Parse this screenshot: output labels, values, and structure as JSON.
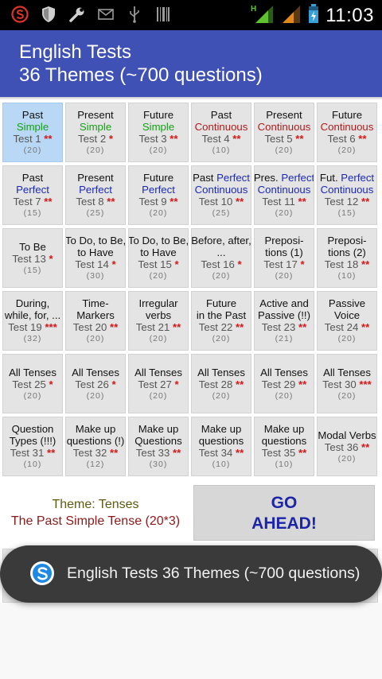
{
  "status_bar": {
    "time": "11:03",
    "left_icons": [
      "app-s-icon",
      "shield-icon",
      "wrench-icon",
      "mail-icon",
      "usb-icon",
      "barcode-icon"
    ],
    "network_label": "H",
    "colors": {
      "signal_green": "#5fc12f",
      "signal_orange": "#e08a1e",
      "battery": "#37a0d8"
    }
  },
  "app_bar": {
    "title": "English Tests",
    "subtitle": "36 Themes (~700 questions)",
    "color": "#3f51b5"
  },
  "tiles": [
    {
      "line1": "Past",
      "line2": "Simple",
      "line2_color": "green",
      "test": "Test 1",
      "stars": "**",
      "count": "(20)",
      "selected": true
    },
    {
      "line1": "Present",
      "line2": "Simple",
      "line2_color": "green",
      "test": "Test 2",
      "stars": "*",
      "count": "(20)"
    },
    {
      "line1": "Future",
      "line2": "Simple",
      "line2_color": "green",
      "test": "Test 3",
      "stars": "**",
      "count": "(20)"
    },
    {
      "line1": "Past",
      "line2": "Continuous",
      "line2_color": "red",
      "test": "Test 4",
      "stars": "**",
      "count": "(10)"
    },
    {
      "line1": "Present",
      "line2": "Continuous",
      "line2_color": "red",
      "test": "Test 5",
      "stars": "**",
      "count": "(20)"
    },
    {
      "line1": "Future",
      "line2": "Continuous",
      "line2_color": "red",
      "test": "Test 6",
      "stars": "**",
      "count": "(20)"
    },
    {
      "line1": "Past",
      "line2": "Perfect",
      "line2_color": "blue",
      "test": "Test 7",
      "stars": "**",
      "count": "(15)"
    },
    {
      "line1": "Present",
      "line2": "Perfect",
      "line2_color": "blue",
      "test": "Test 8",
      "stars": "**",
      "count": "(25)"
    },
    {
      "line1": "Future",
      "line2": "Perfect",
      "line2_color": "blue",
      "test": "Test 9",
      "stars": "**",
      "count": "(20)"
    },
    {
      "line1a": "Past ",
      "line1b": "Perfect",
      "line2": "Continuous",
      "line2_color": "blue",
      "test": "Test 10",
      "stars": "**",
      "count": "(25)"
    },
    {
      "line1a": "Pres. ",
      "line1b": "Perfect",
      "line2": "Continuous",
      "line2_color": "blue",
      "test": "Test 11",
      "stars": "**",
      "count": "(20)"
    },
    {
      "line1a": "Fut. ",
      "line1b": "Perfect",
      "line2": "Continuous",
      "line2_color": "blue",
      "test": "Test 12",
      "stars": "**",
      "count": "(15)"
    },
    {
      "line1": "To Be",
      "test": "Test 13",
      "stars": "*",
      "count": "(15)"
    },
    {
      "line1": "To Do, to Be,",
      "line2": "to Have",
      "test": "Test 14",
      "stars": "*",
      "count": "(30)"
    },
    {
      "line1": "To Do, to Be,",
      "line2": "to Have",
      "test": "Test 15",
      "stars": "*",
      "count": "(20)"
    },
    {
      "line1": "Before, after,",
      "line2": "...",
      "test": "Test 16",
      "stars": "*",
      "count": "(20)"
    },
    {
      "line1": "Preposi-",
      "line2": "tions (1)",
      "test": "Test 17",
      "stars": "*",
      "count": "(20)"
    },
    {
      "line1": "Preposi-",
      "line2": "tions (2)",
      "test": "Test 18",
      "stars": "**",
      "count": "(10)"
    },
    {
      "line1": "During,",
      "line2": "while, for, ...",
      "test": "Test 19",
      "stars": "***",
      "count": "(32)"
    },
    {
      "line1": "Time-",
      "line2": "Markers",
      "test": "Test 20",
      "stars": "**",
      "count": "(20)"
    },
    {
      "line1": "Irregular",
      "line2": "verbs",
      "test": "Test 21",
      "stars": "**",
      "count": "(20)"
    },
    {
      "line1": "Future",
      "line2": "in the Past",
      "test": "Test 22",
      "stars": "**",
      "count": "(20)"
    },
    {
      "line1": "Active and",
      "line2": "Passive (!!)",
      "test": "Test 23",
      "stars": "**",
      "count": "(21)"
    },
    {
      "line1": "Passive",
      "line2": "Voice",
      "test": "Test 24",
      "stars": "**",
      "count": "(20)"
    },
    {
      "line1": "All Tenses",
      "test": "Test 25",
      "stars": "*",
      "count": "(20)"
    },
    {
      "line1": "All Tenses",
      "test": "Test 26",
      "stars": "*",
      "count": "(20)"
    },
    {
      "line1": "All Tenses",
      "test": "Test 27",
      "stars": "*",
      "count": "(20)"
    },
    {
      "line1": "All Tenses",
      "test": "Test 28",
      "stars": "**",
      "count": "(20)"
    },
    {
      "line1": "All Tenses",
      "test": "Test 29",
      "stars": "**",
      "count": "(20)"
    },
    {
      "line1": "All Tenses",
      "test": "Test 30",
      "stars": "***",
      "count": "(20)"
    },
    {
      "line1": "Question",
      "line2": "Types (!!!)",
      "test": "Test 31",
      "stars": "**",
      "count": "(10)"
    },
    {
      "line1": "Make up",
      "line2": "questions (!)",
      "test": "Test 32",
      "stars": "**",
      "count": "(12)"
    },
    {
      "line1": "Make up",
      "line2": "Questions",
      "test": "Test 33",
      "stars": "**",
      "count": "(30)"
    },
    {
      "line1": "Make up",
      "line2": "questions",
      "test": "Test 34",
      "stars": "**",
      "count": "(10)"
    },
    {
      "line1": "Make up",
      "line2": "questions",
      "test": "Test 35",
      "stars": "**",
      "count": "(10)"
    },
    {
      "line1": "Modal Verbs",
      "test": "Test 36",
      "stars": "**",
      "count": "(20)"
    }
  ],
  "theme": {
    "label": "Theme: Tenses",
    "detail": "The Past Simple Tense (20*3)"
  },
  "go_button": {
    "line1": "GO",
    "line2": "AHEAD!"
  },
  "toast": {
    "text": "English Tests 36 Themes (~700 questions)",
    "icon": "skype-style-s-icon"
  }
}
